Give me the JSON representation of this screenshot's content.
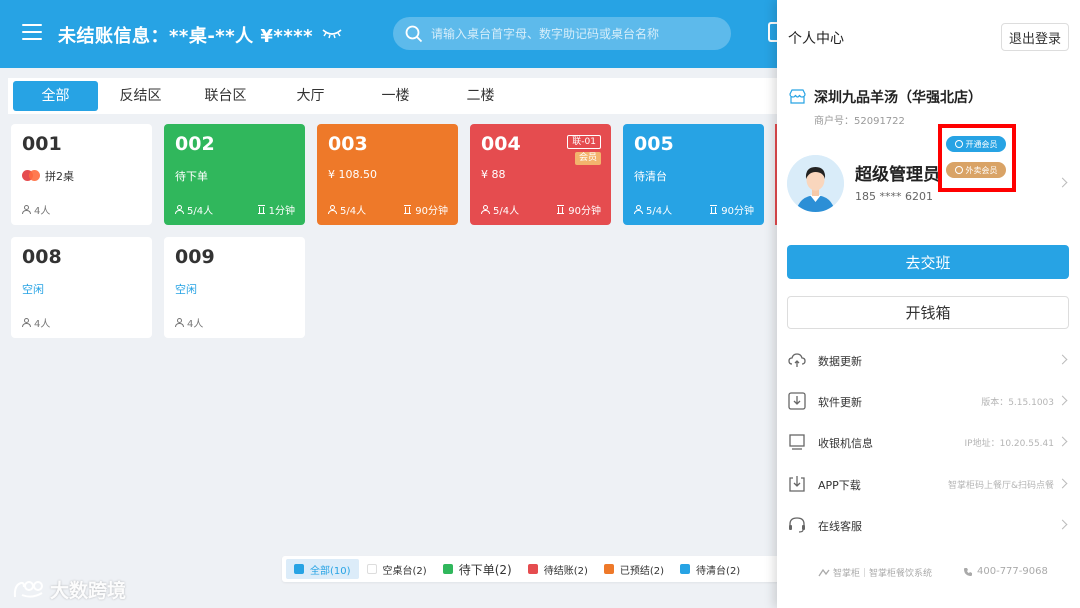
{
  "header": {
    "title": "未结账信息：**桌-**人  ¥****",
    "search_placeholder": "请输入桌台首字母、数字助记码或桌台名称"
  },
  "area_tabs": [
    "全部",
    "反结区",
    "联台区",
    "大厅",
    "一楼",
    "二楼"
  ],
  "tables": [
    {
      "num": "001",
      "status": "拼2桌",
      "guests": "4人",
      "duration": ""
    },
    {
      "num": "002",
      "status": "待下单",
      "guests": "5/4人",
      "duration": "1分钟"
    },
    {
      "num": "003",
      "status": "¥ 108.50",
      "guests": "5/4人",
      "duration": "90分钟"
    },
    {
      "num": "004",
      "status": "¥ 88",
      "guests": "5/4人",
      "duration": "90分钟",
      "tag_join": "联-01",
      "tag_member": "会员"
    },
    {
      "num": "005",
      "status": "待清台",
      "guests": "5/4人",
      "duration": "90分钟"
    },
    {
      "num": "008",
      "status": "空闲",
      "guests": "4人",
      "duration": ""
    },
    {
      "num": "009",
      "status": "空闲",
      "guests": "4人",
      "duration": ""
    }
  ],
  "legend": [
    {
      "label": "全部(10)",
      "color": "#27a3e4"
    },
    {
      "label": "空桌台(2)",
      "color": "#ffffff"
    },
    {
      "label": "待下单(2)",
      "color": "#30b75c"
    },
    {
      "label": "待结账(2)",
      "color": "#e54c4f"
    },
    {
      "label": "已预结(2)",
      "color": "#ee7929"
    },
    {
      "label": "待清台(2)",
      "color": "#27a3e4"
    }
  ],
  "watermark": "大数跨境",
  "drawer": {
    "title": "个人中心",
    "logout": "退出登录",
    "store_name": "深圳九品羊汤（华强北店）",
    "merchant_no": "商户号：52091722",
    "admin_name": "超级管理员",
    "phone": "185 **** 6201",
    "badge_open": "开通会员",
    "badge_takeout": "外卖会员",
    "handover": "去交班",
    "cashbox": "开钱箱",
    "menu": [
      {
        "label": "数据更新",
        "value": ""
      },
      {
        "label": "软件更新",
        "value": "版本：5.15.1003"
      },
      {
        "label": "收银机信息",
        "value": "IP地址：10.20.55.41"
      },
      {
        "label": "APP下载",
        "value": "智掌柜码上餐厅&扫码点餐"
      },
      {
        "label": "在线客服",
        "value": ""
      }
    ],
    "footer_brand": "智掌柜｜智掌柜餐饮系统",
    "footer_phone": "400-777-9068"
  }
}
